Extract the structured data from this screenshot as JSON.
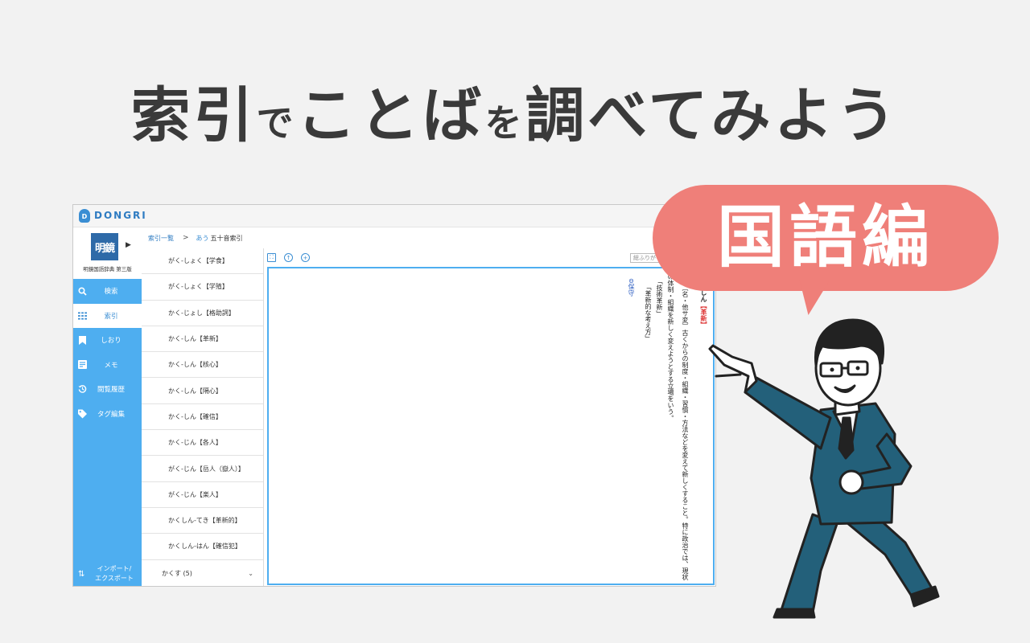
{
  "headline": {
    "part1": "索引",
    "part2": "で",
    "part3": "ことば",
    "part4": "を",
    "part5": "調べてみよう"
  },
  "bubble": {
    "text": "国語編"
  },
  "app": {
    "brand": "DONGRI",
    "brand_mark": "D",
    "dictionary": {
      "cover_text": "明鏡",
      "name": "明鏡国語辞典 第三版"
    },
    "sidebar": {
      "items": [
        {
          "label": "検索",
          "icon": "search-icon"
        },
        {
          "label": "索引",
          "icon": "grid-icon"
        },
        {
          "label": "しおり",
          "icon": "bookmark-icon"
        },
        {
          "label": "メモ",
          "icon": "memo-icon"
        },
        {
          "label": "閲覧履歴",
          "icon": "history-icon"
        },
        {
          "label": "タグ編集",
          "icon": "tag-icon"
        }
      ],
      "import_export": {
        "line1": "インポート/",
        "line2": "エクスポート"
      }
    },
    "breadcrumb": {
      "root": "索引一覧",
      "separator": ">",
      "icon_text": "あう",
      "current": "五十音索引"
    },
    "index_list": [
      "がく-しょく【学食】",
      "がく-しょく【学殖】",
      "かく-じょし【格助詞】",
      "かく-しん【革新】",
      "かく-しん【核心】",
      "かく-しん【隔心】",
      "かく-しん【確信】",
      "かく-じん【各人】",
      "がく-じん【岳人（嶽人）】",
      "がく-じん【楽人】",
      "かくしん-てき【革新的】",
      "かくしん-はん【確信犯】"
    ],
    "index_group": {
      "label": "かくす (5)"
    },
    "toolbar": {
      "search_placeholder": "総ふりが"
    },
    "entry": {
      "headword_kana": "しん",
      "headword_kanji": "【革新】",
      "col1": "〔名・他サ変〕古くからの制度・組織・習慣・方法などを変えて新しくすること。特に政治では、現状",
      "col2": "の体制・組織を新しく変えようとする立場をいう。",
      "col3": "「技術革新」",
      "col4": "「革新的な考え方」",
      "antonym_mark": "⊜",
      "antonym": "保守"
    }
  },
  "colors": {
    "accent": "#4eaef0",
    "bubble": "#ef7f79",
    "suit": "#23607a",
    "headline": "#3a3a3a"
  }
}
